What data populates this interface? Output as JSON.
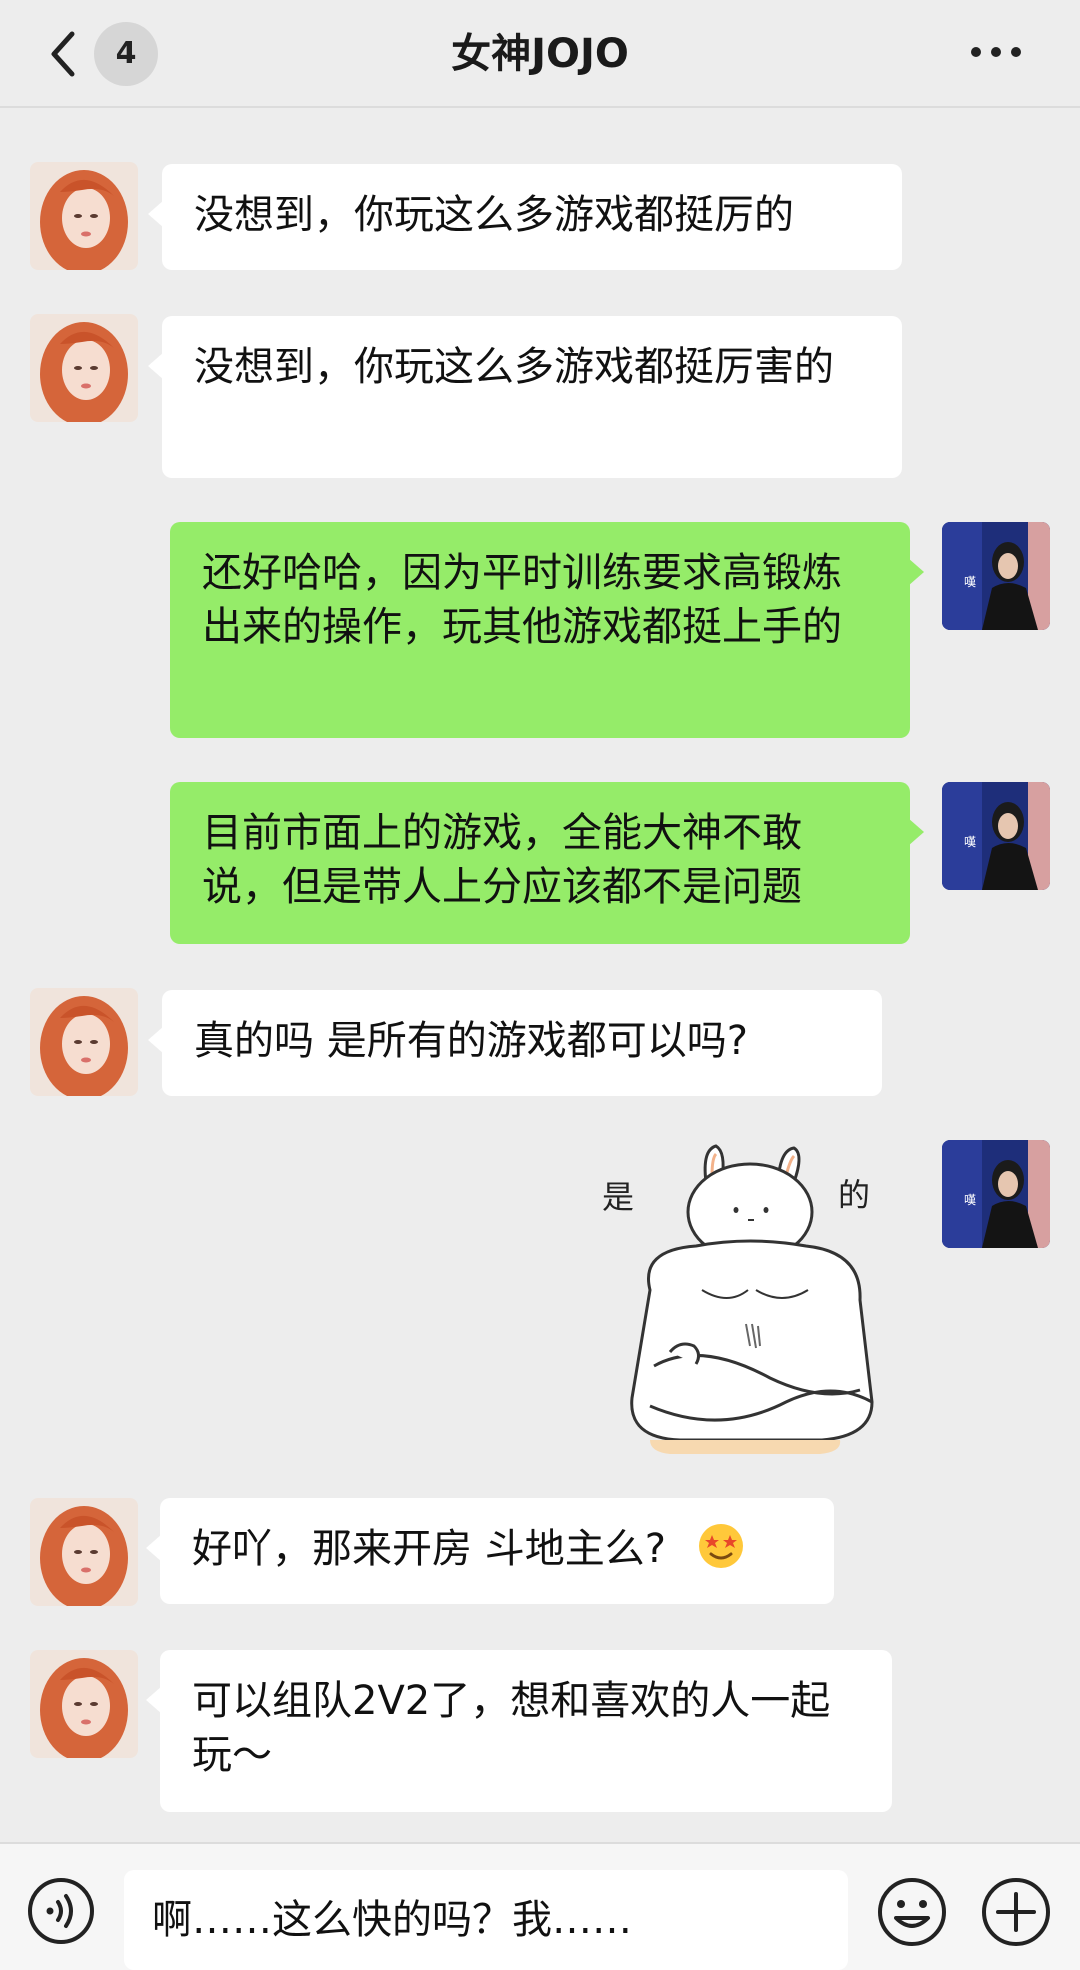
{
  "header": {
    "title": "女神JOJO",
    "unread_count": "4",
    "back_icon": "chevron-left-icon",
    "more_icon": "more-dots-icon"
  },
  "messages": [
    {
      "side": "left",
      "text": "没想到，你玩这么多游戏都挺厉的"
    },
    {
      "side": "left",
      "text": "没想到，你玩这么多游戏都挺厉害的"
    },
    {
      "side": "right",
      "text": "还好哈哈，因为平时训练要求高锻炼出来的操作，玩其他游戏都挺上手的"
    },
    {
      "side": "right",
      "text": "目前市面上的游戏，全能大神不敢说，但是带人上分应该都不是问题"
    },
    {
      "side": "left",
      "text": "真的吗  是所有的游戏都可以吗?"
    },
    {
      "side": "right",
      "type": "sticker",
      "caption_left": "是",
      "caption_right": "的"
    },
    {
      "side": "left",
      "text": "好吖，那来开房 斗地主么?",
      "emoji": "star-struck-emoji"
    },
    {
      "side": "left",
      "text": "可以组队2V2了，想和喜欢的人一起玩～"
    }
  ],
  "input": {
    "value": "啊……这么快的吗？我……",
    "voice_icon": "voice-icon",
    "emoji_icon": "smile-icon",
    "plus_icon": "plus-icon"
  },
  "colors": {
    "background": "#ededed",
    "left_bubble": "#ffffff",
    "right_bubble": "#95ec69"
  }
}
